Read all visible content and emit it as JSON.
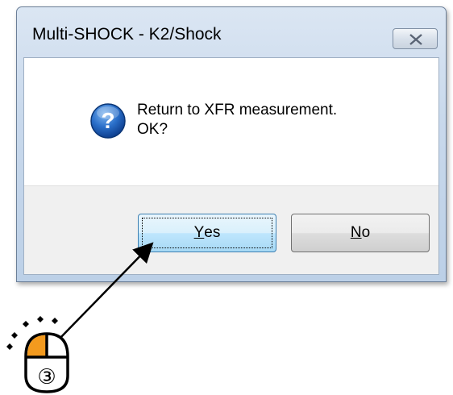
{
  "dialog": {
    "title": "Multi-SHOCK - K2/Shock",
    "close_icon": "close-x-icon",
    "message_line1": "Return to XFR measurement.",
    "message_line2": "OK?",
    "icon": "question-icon",
    "buttons": {
      "yes": {
        "mnemonic": "Y",
        "rest": "es"
      },
      "no": {
        "mnemonic": "N",
        "rest": "o"
      }
    }
  },
  "annotation": {
    "mouse_icon": "mouse-left-click-icon",
    "step_number": "③",
    "highlight_color": "#f39a1e",
    "arrow_color": "#000000"
  }
}
